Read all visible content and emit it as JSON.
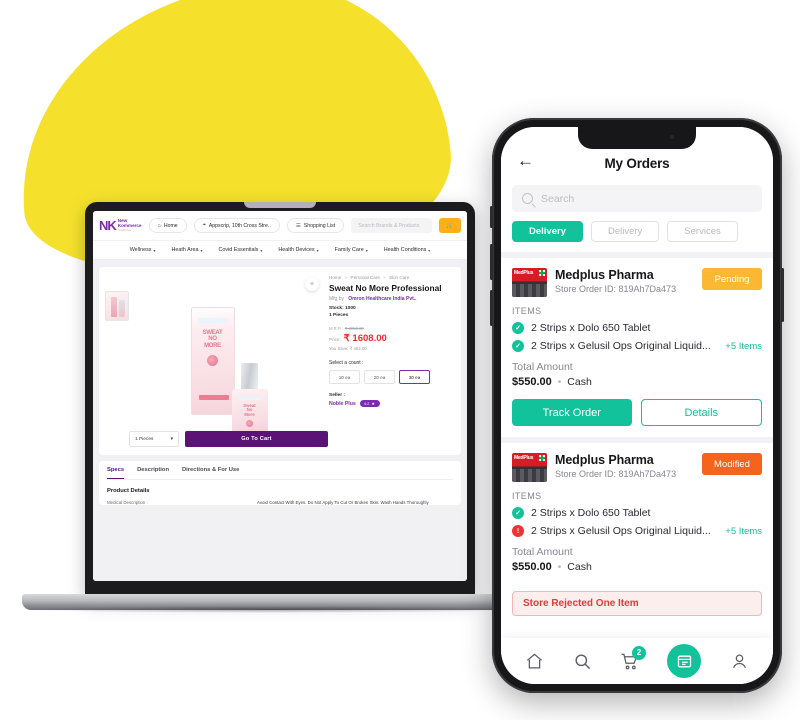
{
  "desktop": {
    "brand": {
      "mark": "NK",
      "line1": "New",
      "line2": "Kommerce",
      "line3": "healthcare"
    },
    "header": {
      "home_label": "Home",
      "home_icon": "home-icon",
      "location_label": "Appscrip, 10th Cross Stre..",
      "location_icon": "pin-icon",
      "shopping_list_label": "Shopping List",
      "shopping_list_icon": "list-icon",
      "search_placeholder": "Search Brands & Products",
      "cart_label": "Cart"
    },
    "nav": [
      {
        "label": "Wellness"
      },
      {
        "label": "Heath Area"
      },
      {
        "label": "Covid Essentials"
      },
      {
        "label": "Health Devices"
      },
      {
        "label": "Family Care"
      },
      {
        "label": "Health Conditions"
      }
    ],
    "product": {
      "breadcrumb": [
        "Home",
        "Personal Care",
        "Skin Care"
      ],
      "title": "Sweat No More Professional",
      "mfg_label": "Mfg by :",
      "mfg_value": "Omron Healthcare India Pvt..",
      "stock": "Stock: 1000",
      "pieces": "1 Pieces",
      "mrp_label": "M.R.P. :",
      "mrp_value": "₹ 2050.00",
      "price_label": "Price:",
      "price_value": "₹ 1608.00",
      "save_text": "You Save: ₹ 462.00",
      "count_label": "Select a count :",
      "counts": [
        {
          "label": "10 ea",
          "selected": false
        },
        {
          "label": "20 ea",
          "selected": false
        },
        {
          "label": "30 ea",
          "selected": true
        }
      ],
      "seller_label": "Seller :",
      "seller_name": "Noble Plus",
      "seller_rating": "4.2",
      "qty_value": "1 Pieces",
      "cart_button": "Go To Cart",
      "wishlist_icon": "heart-icon"
    },
    "tabs": [
      {
        "label": "Specs",
        "active": true
      },
      {
        "label": "Description",
        "active": false
      },
      {
        "label": "Directions & For Use",
        "active": false
      }
    ],
    "details": {
      "heading": "Product Details",
      "key": "Medical Description :",
      "value": "Avoid Contact With Eyes. Do Not Apply To Cut Or Broken Skin. Wash Hands Thoroughly"
    }
  },
  "phone": {
    "title": "My Orders",
    "back_icon": "back-arrow-icon",
    "search_placeholder": "Search",
    "search_icon": "search-icon",
    "filters": [
      {
        "label": "Delivery",
        "active": true
      },
      {
        "label": "Delivery",
        "active": false
      },
      {
        "label": "Services",
        "active": false
      }
    ],
    "orders": [
      {
        "store": "Medplus Pharma",
        "order_id": "Store Order ID: 819Ah7Da473",
        "status": "Pending",
        "status_color": "#fcb733",
        "items_label": "ITEMS",
        "items": [
          {
            "text": "2 Strips x Dolo 650 Tablet",
            "state": "ok"
          },
          {
            "text": "2 Strips x Gelusil Ops Original Liquid...",
            "state": "ok"
          }
        ],
        "more_items": "+5 Items",
        "total_label": "Total Amount",
        "total_amount": "$550.00",
        "payment": "Cash",
        "track_label": "Track Order",
        "details_label": "Details"
      },
      {
        "store": "Medplus Pharma",
        "order_id": "Store Order ID: 819Ah7Da473",
        "status": "Modified",
        "status_color": "#f4641c",
        "items_label": "ITEMS",
        "items": [
          {
            "text": "2 Strips x Dolo 650 Tablet",
            "state": "ok"
          },
          {
            "text": "2 Strips x Gelusil Ops Original Liquid...",
            "state": "bad"
          }
        ],
        "more_items": "+5 Items",
        "total_label": "Total Amount",
        "total_amount": "$550.00",
        "payment": "Cash",
        "reject_note": "Store Rejected One Item"
      }
    ],
    "tabbar": [
      {
        "icon": "home-icon",
        "active": false
      },
      {
        "icon": "search-icon",
        "active": false
      },
      {
        "icon": "cart-icon",
        "badge": "2",
        "active": false
      },
      {
        "icon": "orders-icon",
        "active": true
      },
      {
        "icon": "profile-icon",
        "active": false
      }
    ]
  },
  "colors": {
    "brand_purple": "#5b1276",
    "accent_teal": "#12c29a",
    "yellow": "#f5e12c",
    "pending": "#fcb733",
    "modified": "#f4641c",
    "price_red": "#ef2b2b"
  }
}
